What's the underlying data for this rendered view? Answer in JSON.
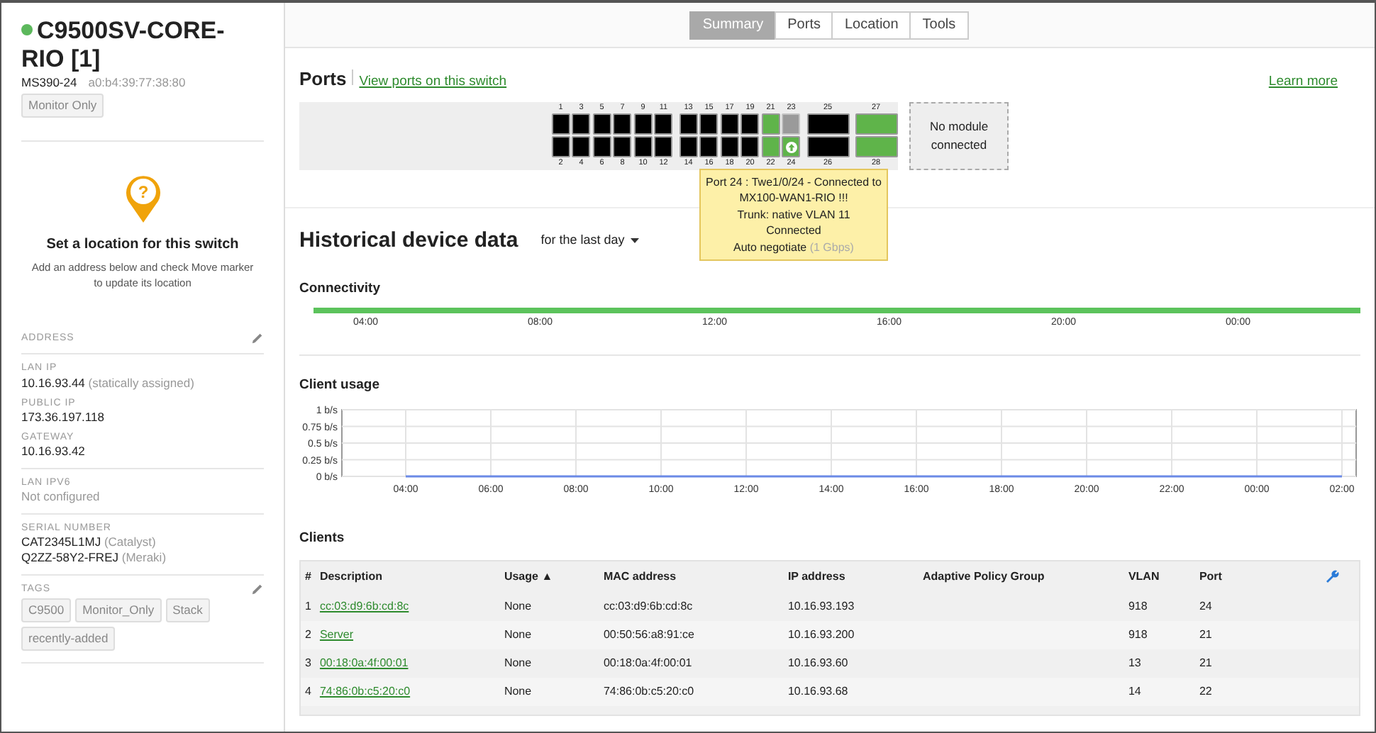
{
  "device": {
    "online": true,
    "name": "C9500SV-CORE-RIO [1]",
    "model": "MS390-24",
    "mac": "a0:b4:39:77:38:80",
    "badge": "Monitor Only"
  },
  "location": {
    "pin_glyph": "?",
    "title": "Set a location for this switch",
    "text": "Add an address below and check Move marker to update its location"
  },
  "details": [
    {
      "editable": true,
      "fields": [
        {
          "label": "ADDRESS"
        }
      ]
    },
    {
      "editable": false,
      "fields": [
        {
          "label": "LAN IP",
          "lines": [
            {
              "value": "10.16.93.44",
              "note": "(statically assigned)"
            }
          ]
        },
        {
          "label": "PUBLIC IP",
          "lines": [
            {
              "value": "173.36.197.118"
            }
          ]
        },
        {
          "label": "GATEWAY",
          "lines": [
            {
              "value": "10.16.93.42"
            }
          ]
        }
      ]
    },
    {
      "editable": false,
      "fields": [
        {
          "label": "LAN IPV6",
          "lines": [
            {
              "note": "Not configured"
            }
          ]
        }
      ]
    },
    {
      "editable": false,
      "fields": [
        {
          "label": "SERIAL NUMBER",
          "lines": [
            {
              "value": "CAT2345L1MJ",
              "note": "(Catalyst)"
            },
            {
              "value": "Q2ZZ-58Y2-FREJ",
              "note": "(Meraki)"
            }
          ]
        }
      ]
    }
  ],
  "tags": {
    "label": "TAGS",
    "editable": true,
    "items": [
      "C9500",
      "Monitor_Only",
      "Stack",
      "recently-added"
    ]
  },
  "tabs": [
    {
      "label": "Summary",
      "selected": true
    },
    {
      "label": "Ports",
      "selected": false
    },
    {
      "label": "Location",
      "selected": false
    },
    {
      "label": "Tools",
      "selected": false
    }
  ],
  "ports_section": {
    "title": "Ports",
    "link": "View ports on this switch",
    "learn_more": "Learn more",
    "module_text": "No module connected"
  },
  "ports": [
    {
      "label": "1",
      "kind": "rj45",
      "connected": false,
      "enabled": true,
      "uplink": false
    },
    {
      "label": "2",
      "kind": "rj45",
      "connected": false,
      "enabled": true,
      "uplink": false
    },
    {
      "label": "3",
      "kind": "rj45",
      "connected": false,
      "enabled": true,
      "uplink": false
    },
    {
      "label": "4",
      "kind": "rj45",
      "connected": false,
      "enabled": true,
      "uplink": false
    },
    {
      "label": "5",
      "kind": "rj45",
      "connected": false,
      "enabled": true,
      "uplink": false
    },
    {
      "label": "6",
      "kind": "rj45",
      "connected": false,
      "enabled": true,
      "uplink": false
    },
    {
      "label": "7",
      "kind": "rj45",
      "connected": false,
      "enabled": true,
      "uplink": false
    },
    {
      "label": "8",
      "kind": "rj45",
      "connected": false,
      "enabled": true,
      "uplink": false
    },
    {
      "label": "9",
      "kind": "rj45",
      "connected": false,
      "enabled": true,
      "uplink": false
    },
    {
      "label": "10",
      "kind": "rj45",
      "connected": false,
      "enabled": true,
      "uplink": false
    },
    {
      "label": "11",
      "kind": "rj45",
      "connected": false,
      "enabled": true,
      "uplink": false
    },
    {
      "label": "12",
      "kind": "rj45",
      "connected": false,
      "enabled": true,
      "uplink": false
    },
    {
      "label": "13",
      "kind": "rj45",
      "connected": false,
      "enabled": true,
      "uplink": false
    },
    {
      "label": "14",
      "kind": "rj45",
      "connected": false,
      "enabled": true,
      "uplink": false
    },
    {
      "label": "15",
      "kind": "rj45",
      "connected": false,
      "enabled": true,
      "uplink": false
    },
    {
      "label": "16",
      "kind": "rj45",
      "connected": false,
      "enabled": true,
      "uplink": false
    },
    {
      "label": "17",
      "kind": "rj45",
      "connected": false,
      "enabled": true,
      "uplink": false
    },
    {
      "label": "18",
      "kind": "rj45",
      "connected": false,
      "enabled": true,
      "uplink": false
    },
    {
      "label": "19",
      "kind": "rj45",
      "connected": false,
      "enabled": true,
      "uplink": false
    },
    {
      "label": "20",
      "kind": "rj45",
      "connected": false,
      "enabled": true,
      "uplink": false
    },
    {
      "label": "21",
      "kind": "rj45",
      "connected": true,
      "enabled": true,
      "uplink": false
    },
    {
      "label": "22",
      "kind": "rj45",
      "connected": true,
      "enabled": true,
      "uplink": false
    },
    {
      "label": "23",
      "kind": "rj45",
      "connected": false,
      "enabled": false,
      "uplink": false
    },
    {
      "label": "24",
      "kind": "rj45",
      "connected": true,
      "enabled": true,
      "uplink": true
    },
    {
      "label": "25",
      "kind": "sfp",
      "connected": false,
      "enabled": true,
      "uplink": false
    },
    {
      "label": "26",
      "kind": "sfp",
      "connected": false,
      "enabled": true,
      "uplink": false
    },
    {
      "label": "27",
      "kind": "sfp",
      "connected": true,
      "enabled": true,
      "uplink": false
    },
    {
      "label": "28",
      "kind": "sfp",
      "connected": true,
      "enabled": true,
      "uplink": false
    }
  ],
  "tooltip": {
    "lines": [
      {
        "text": "Port 24 : Twe1/0/24 - Connected to MX100-WAN1-RIO !!!"
      },
      {
        "text": "Trunk: native VLAN 11"
      },
      {
        "text": "Connected"
      },
      {
        "text": "Auto negotiate",
        "note": "(1 Gbps)"
      }
    ]
  },
  "history": {
    "title": "Historical device data",
    "range": "for the last day"
  },
  "connectivity": {
    "title": "Connectivity",
    "time_labels": [
      "04:00",
      "08:00",
      "12:00",
      "16:00",
      "20:00",
      "00:00"
    ]
  },
  "client_usage": {
    "title": "Client usage",
    "chart_data": {
      "type": "line",
      "grid": true,
      "categories": [
        "04:00",
        "06:00",
        "08:00",
        "10:00",
        "12:00",
        "14:00",
        "16:00",
        "18:00",
        "20:00",
        "22:00",
        "00:00",
        "02:00"
      ],
      "ylim": [
        0,
        1
      ],
      "yticks": [
        {
          "value": 0,
          "label": "0 b/s"
        },
        {
          "value": 0.25,
          "label": "0.25 b/s"
        },
        {
          "value": 0.5,
          "label": "0.5 b/s"
        },
        {
          "value": 0.75,
          "label": "0.75 b/s"
        },
        {
          "value": 1,
          "label": "1 b/s"
        }
      ],
      "series": [
        {
          "color": "#6b8ae6",
          "values": [
            0,
            0,
            0,
            0,
            0,
            0,
            0,
            0,
            0,
            0,
            0,
            0
          ]
        }
      ]
    }
  },
  "clients": {
    "title": "Clients",
    "columns": [
      "#",
      "Description",
      "Usage ▲",
      "MAC address",
      "IP address",
      "Adaptive Policy Group",
      "VLAN",
      "Port"
    ],
    "rows": [
      {
        "index": "1",
        "description": "cc:03:d9:6b:cd:8c",
        "usage": "None",
        "mac": "cc:03:d9:6b:cd:8c",
        "ip": "10.16.93.193",
        "vlan": "918",
        "port": "24"
      },
      {
        "index": "2",
        "description": "Server",
        "usage": "None",
        "mac": "00:50:56:a8:91:ce",
        "ip": "10.16.93.200",
        "vlan": "918",
        "port": "21"
      },
      {
        "index": "3",
        "description": "00:18:0a:4f:00:01",
        "usage": "None",
        "mac": "00:18:0a:4f:00:01",
        "ip": "10.16.93.60",
        "vlan": "13",
        "port": "21"
      },
      {
        "index": "4",
        "description": "74:86:0b:c5:20:c0",
        "usage": "None",
        "mac": "74:86:0b:c5:20:c0",
        "ip": "10.16.93.68",
        "vlan": "14",
        "port": "22"
      }
    ]
  }
}
